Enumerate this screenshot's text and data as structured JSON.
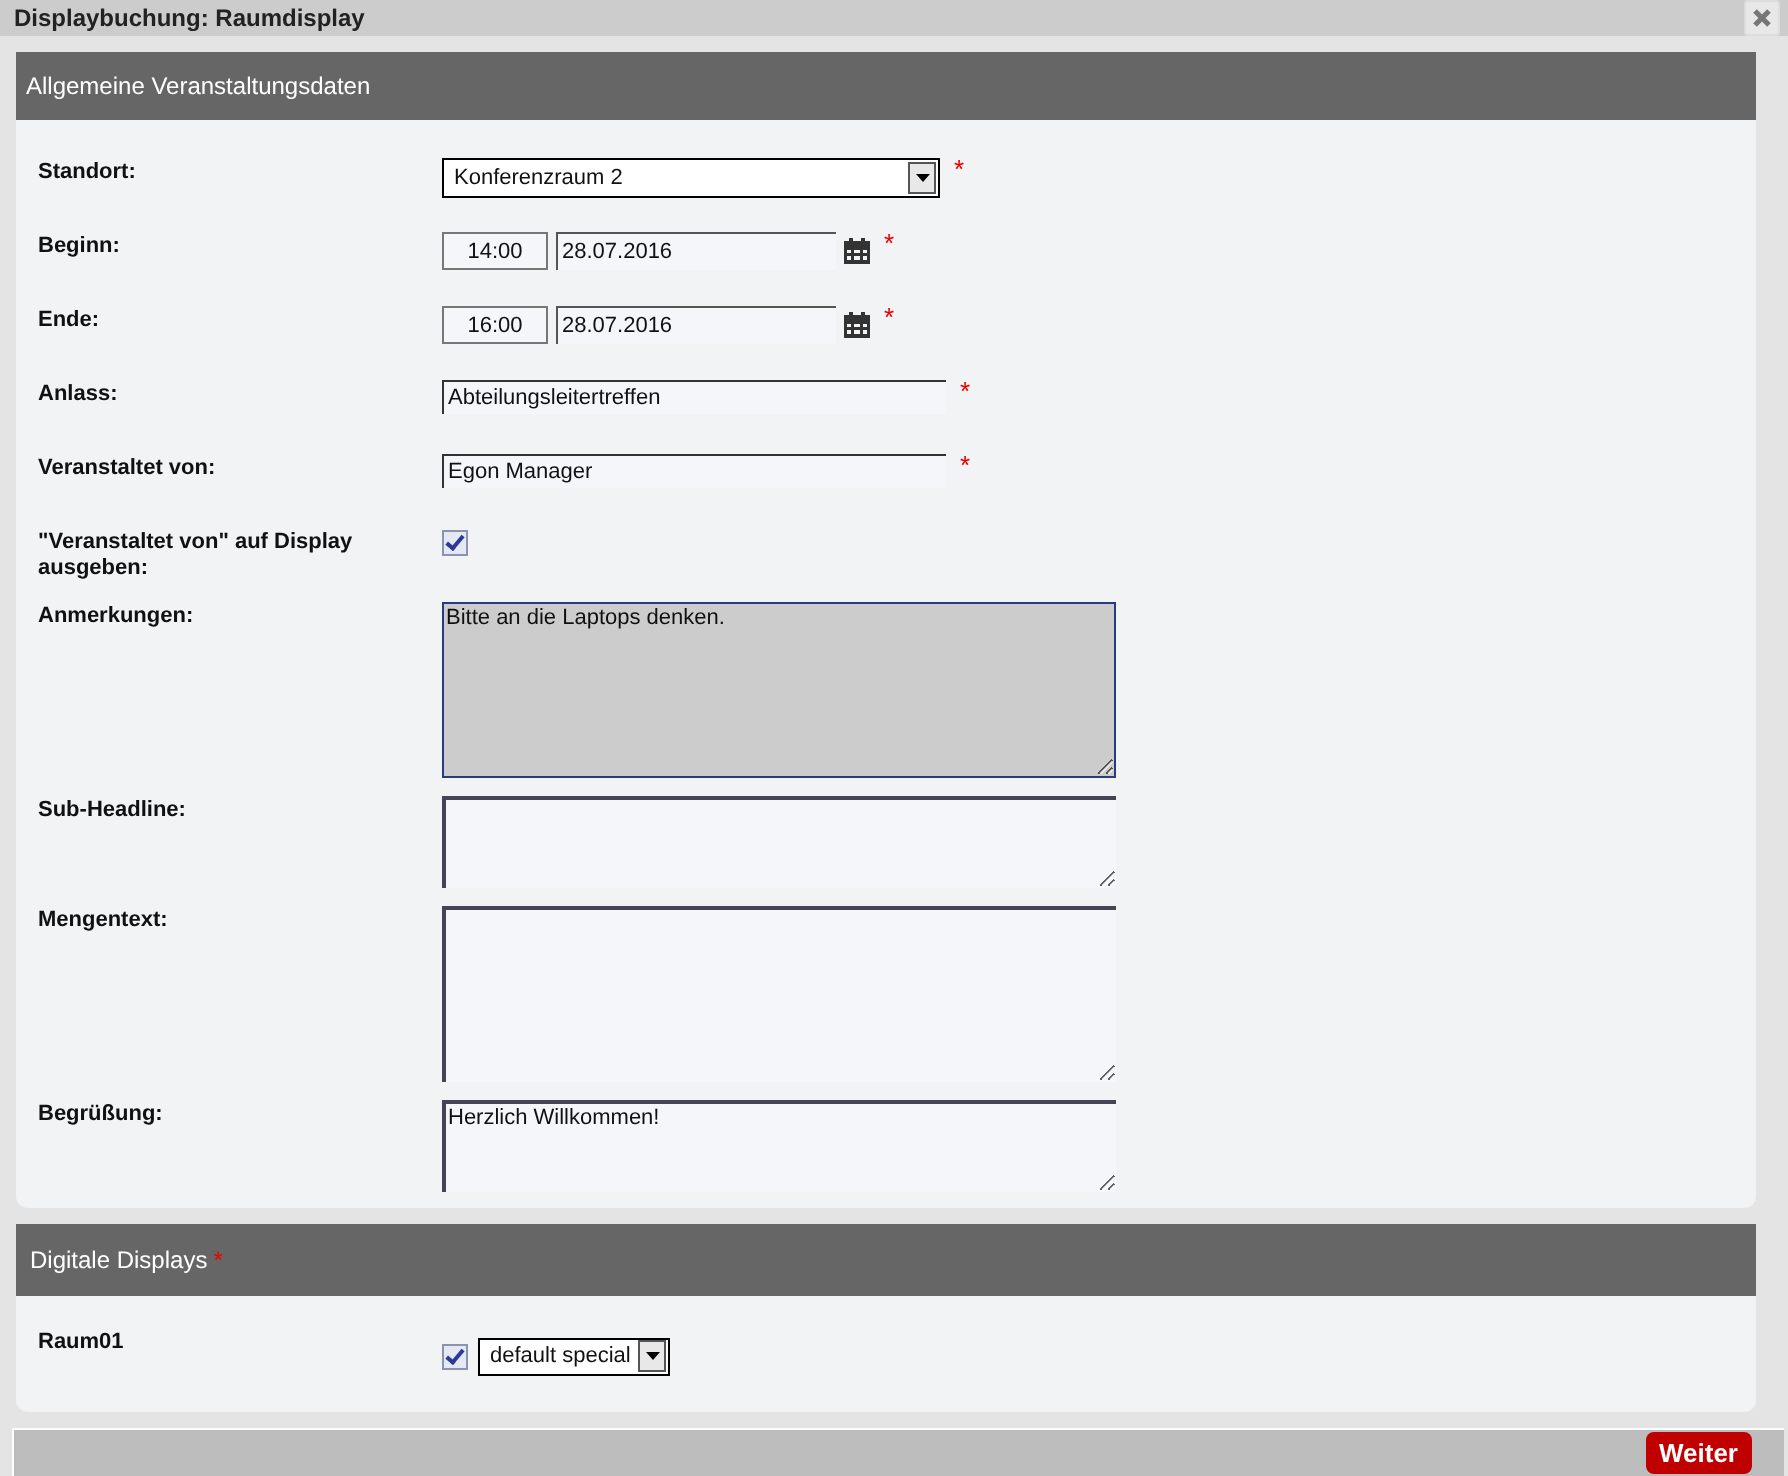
{
  "dialog": {
    "title": "Displaybuchung: Raumdisplay"
  },
  "required_mark": "*",
  "sections": [
    {
      "title": "Allgemeine Veranstaltungsdaten",
      "required": false,
      "fields": [
        {
          "label": "Standort:",
          "kind": "select",
          "value": "Konferenzraum 2",
          "required": true
        },
        {
          "label": "Beginn:",
          "kind": "datetime",
          "time": "14:00",
          "date": "28.07.2016",
          "required": true
        },
        {
          "label": "Ende:",
          "kind": "datetime",
          "time": "16:00",
          "date": "28.07.2016",
          "required": true
        },
        {
          "label": "Anlass:",
          "kind": "text",
          "value": "Abteilungsleitertreffen",
          "required": true
        },
        {
          "label": "Veranstaltet von:",
          "kind": "text",
          "value": "Egon Manager",
          "required": true
        },
        {
          "label": "\"Veranstaltet von\" auf Display ausgeben:",
          "kind": "checkbox",
          "checked": true,
          "required": false
        },
        {
          "label": "Anmerkungen:",
          "kind": "textarea",
          "value": "Bitte an die Laptops denken.",
          "focused": true,
          "tall": true,
          "required": false
        },
        {
          "label": "Sub-Headline:",
          "kind": "textarea",
          "focused": false,
          "tall": false,
          "required": false
        },
        {
          "label": "Mengentext:",
          "kind": "textarea",
          "focused": false,
          "tall": true,
          "required": false
        },
        {
          "label": "Begrüßung:",
          "kind": "textarea",
          "value": "Herzlich Willkommen!",
          "focused": false,
          "tall": false,
          "required": false
        }
      ]
    },
    {
      "title": "Digitale Displays",
      "required": true,
      "fields": [
        {
          "label": "Raum01",
          "kind": "display",
          "checked": true,
          "value": "default special",
          "required": false
        }
      ]
    }
  ],
  "footer": {
    "button": "Weiter"
  }
}
